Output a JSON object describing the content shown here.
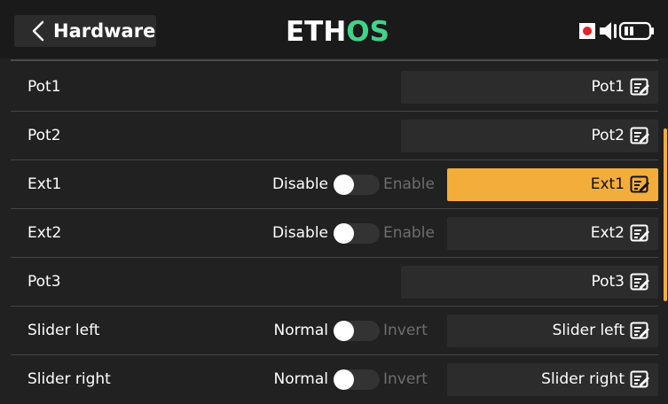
{
  "header": {
    "title": "Hardware",
    "logo_text_a": "ETH",
    "logo_text_b": "OS",
    "icons": [
      "back-chevron-icon",
      "record-icon",
      "speaker-icon",
      "battery-icon"
    ],
    "colors": {
      "logo_white": "#ffffff",
      "logo_green": "#40d38a",
      "record_red": "#e0262a"
    }
  },
  "rows": [
    {
      "label": "Pot1",
      "value": "Pot1"
    },
    {
      "label": "Pot2",
      "value": "Pot2"
    },
    {
      "label": "Ext1",
      "toggle_off": "Disable",
      "toggle_on": "Enable",
      "value": "Ext1",
      "focused": true
    },
    {
      "label": "Ext2",
      "toggle_off": "Disable",
      "toggle_on": "Enable",
      "value": "Ext2"
    },
    {
      "label": "Pot3",
      "value": "Pot3"
    },
    {
      "label": "Slider left",
      "toggle_off": "Normal",
      "toggle_on": "Invert",
      "value": "Slider left"
    },
    {
      "label": "Slider right",
      "toggle_off": "Normal",
      "toggle_on": "Invert",
      "value": "Slider right"
    }
  ],
  "colors": {
    "accent": "#f3ad3a",
    "background": "#212121",
    "field": "#2c2c2c"
  }
}
